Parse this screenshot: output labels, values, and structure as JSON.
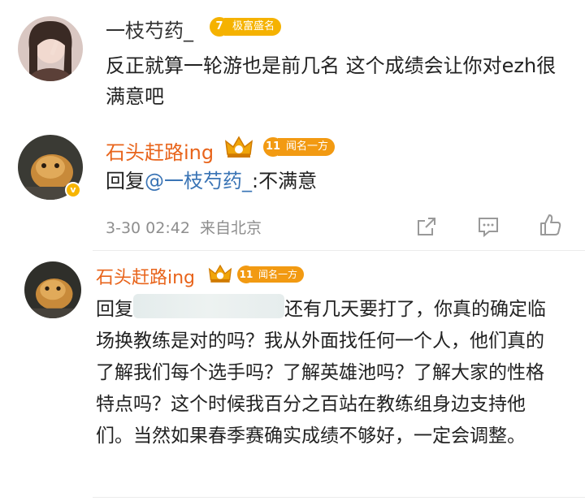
{
  "comment1": {
    "username": "一枝芍药_",
    "badge_level": "7",
    "badge_text": "极富盛名",
    "badge_color": "#f5b200",
    "text": "反正就算一轮游也是前几名 这个成绩会让你对ezh很满意吧"
  },
  "comment2": {
    "username": "石头赶路ing",
    "username_color": "#e8641b",
    "badge_level": "11",
    "badge_text": "闻名一方",
    "badge_color": "#f29a12",
    "reply_prefix": "回复",
    "mention": "@一枝芍药_",
    "reply_text": ":不满意",
    "timestamp": "3-30 02:42",
    "source": "来自北京",
    "verified_mark": "v"
  },
  "comment3": {
    "username": "石头赶路ing",
    "badge_level": "11",
    "badge_text": "闻名一方",
    "reply_prefix": "回复",
    "text": "还有几天要打了，你真的确定临场换教练是对的吗？我从外面找任何一个人，他们真的了解我们每个选手吗？了解英雄池吗？了解大家的性格特点吗？这个时候我百分之百站在教练组身边支持他们。当然如果春季赛确实成绩不够好，一定会调整。"
  },
  "icons": {
    "share": "share-icon",
    "comment": "comment-icon",
    "like": "like-icon",
    "crown": "crown-icon"
  }
}
